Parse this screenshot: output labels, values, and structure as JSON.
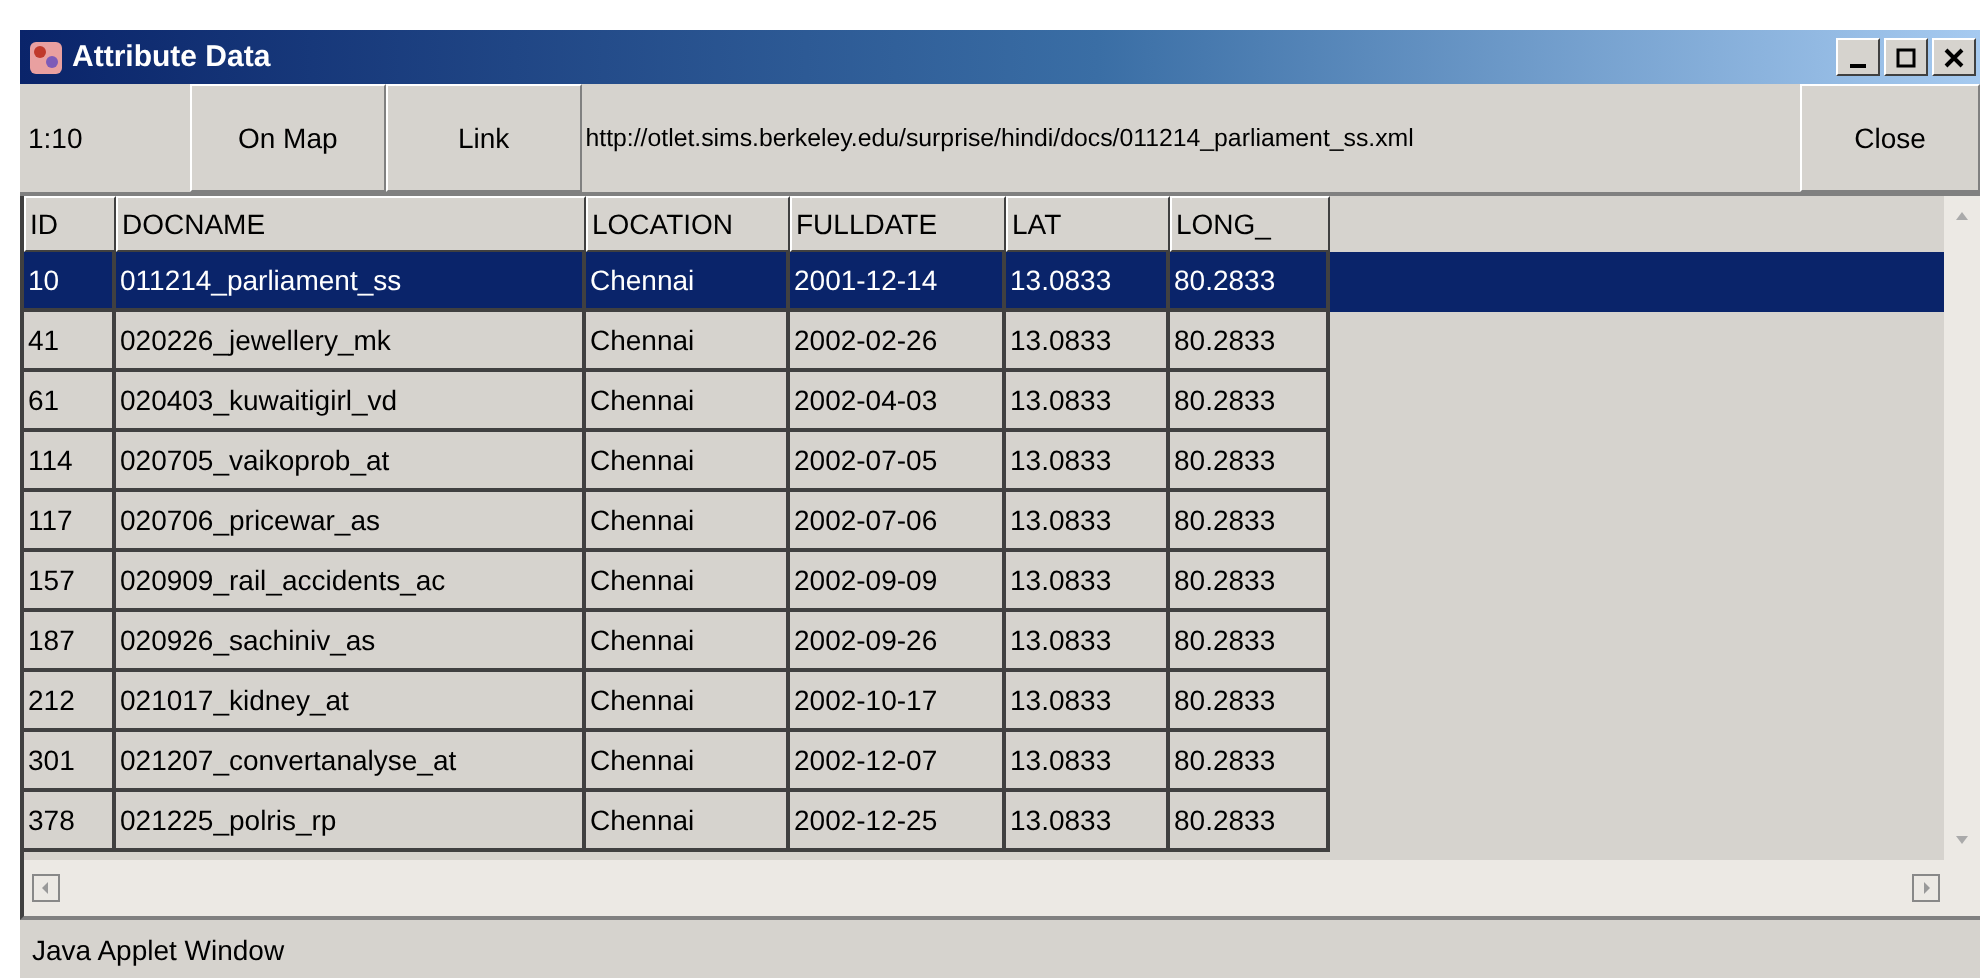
{
  "window": {
    "title": "Attribute Data"
  },
  "toolbar": {
    "range": "1:10",
    "buttons": [
      "On Map",
      "Link"
    ],
    "url": "http://otlet.sims.berkeley.edu/surprise/hindi/docs/011214_parliament_ss.xml",
    "close": "Close"
  },
  "table": {
    "columns": [
      "ID",
      "DOCNAME",
      "LOCATION",
      "FULLDATE",
      "LAT",
      "LONG_"
    ],
    "rows": [
      {
        "selected": true,
        "cells": [
          "10",
          "011214_parliament_ss",
          "Chennai",
          "2001-12-14",
          "13.0833",
          "80.2833"
        ]
      },
      {
        "selected": false,
        "cells": [
          "41",
          "020226_jewellery_mk",
          "Chennai",
          "2002-02-26",
          "13.0833",
          "80.2833"
        ]
      },
      {
        "selected": false,
        "cells": [
          "61",
          "020403_kuwaitigirl_vd",
          "Chennai",
          "2002-04-03",
          "13.0833",
          "80.2833"
        ]
      },
      {
        "selected": false,
        "cells": [
          "114",
          "020705_vaikoprob_at",
          "Chennai",
          "2002-07-05",
          "13.0833",
          "80.2833"
        ]
      },
      {
        "selected": false,
        "cells": [
          "117",
          "020706_pricewar_as",
          "Chennai",
          "2002-07-06",
          "13.0833",
          "80.2833"
        ]
      },
      {
        "selected": false,
        "cells": [
          "157",
          "020909_rail_accidents_ac",
          "Chennai",
          "2002-09-09",
          "13.0833",
          "80.2833"
        ]
      },
      {
        "selected": false,
        "cells": [
          "187",
          "020926_sachiniv_as",
          "Chennai",
          "2002-09-26",
          "13.0833",
          "80.2833"
        ]
      },
      {
        "selected": false,
        "cells": [
          "212",
          "021017_kidney_at",
          "Chennai",
          "2002-10-17",
          "13.0833",
          "80.2833"
        ]
      },
      {
        "selected": false,
        "cells": [
          "301",
          "021207_convertanalyse_at",
          "Chennai",
          "2002-12-07",
          "13.0833",
          "80.2833"
        ]
      },
      {
        "selected": false,
        "cells": [
          "378",
          "021225_polris_rp",
          "Chennai",
          "2002-12-25",
          "13.0833",
          "80.2833"
        ]
      }
    ]
  },
  "status_bar": "Java Applet Window"
}
